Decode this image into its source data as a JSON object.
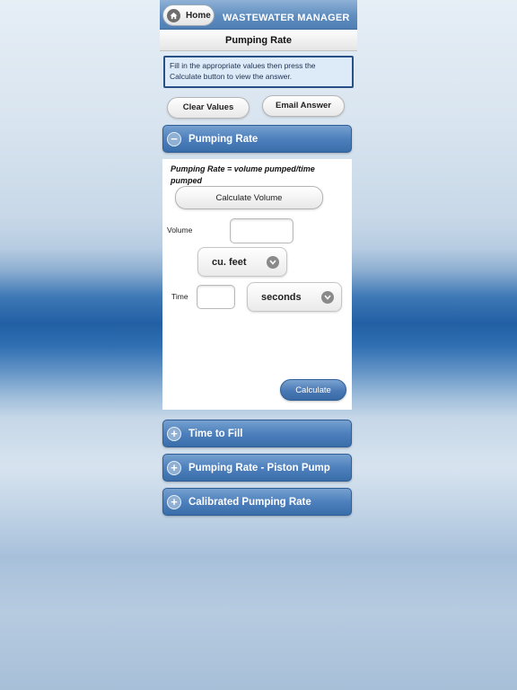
{
  "header": {
    "home_label": "Home",
    "app_title": "WASTEWATER MANAGER"
  },
  "page": {
    "subtitle": "Pumping Rate"
  },
  "info": {
    "text": "Fill in the appropriate values then press the Calculate button to view the answer."
  },
  "actions": {
    "clear_label": "Clear Values",
    "email_label": "Email Answer"
  },
  "sections": {
    "pumping_rate": {
      "title": "Pumping Rate",
      "expanded": true,
      "formula": "Pumping Rate = volume pumped/time pumped",
      "calculate_volume_label": "Calculate Volume",
      "volume_label": "Volume",
      "volume_value": "",
      "volume_unit": "cu. feet",
      "time_label": "Time",
      "time_value": "",
      "time_unit": "seconds",
      "calculate_label": "Calculate"
    },
    "time_to_fill": {
      "title": "Time to Fill",
      "expanded": false
    },
    "piston_pump": {
      "title": "Pumping Rate - Piston Pump",
      "expanded": false
    },
    "calibrated": {
      "title": "Calibrated Pumping Rate",
      "expanded": false
    }
  },
  "icons": {
    "home": "home-icon",
    "collapse": "minus-circle-icon",
    "expand": "plus-circle-icon",
    "dropdown": "chevron-down-icon"
  },
  "colors": {
    "accent_blue": "#4d80bd",
    "info_border": "#284f86"
  }
}
